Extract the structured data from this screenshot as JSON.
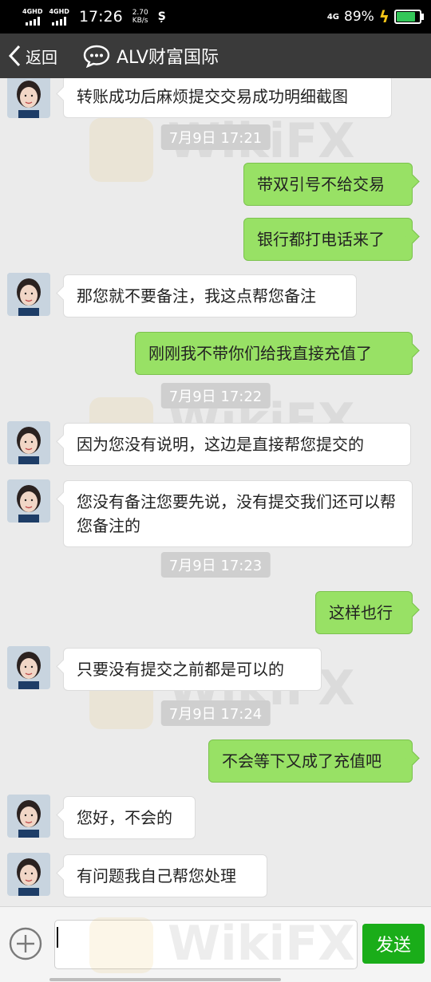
{
  "status": {
    "net1": "4GHD",
    "net2": "4GHD",
    "time": "17:26",
    "speed_value": "2.70",
    "speed_unit": "KB/s",
    "net_right": "4G",
    "battery_percent": "89%",
    "battery_level": 0.89
  },
  "header": {
    "back_label": "返回",
    "title": "ALV财富国际"
  },
  "messages": [
    {
      "type": "in",
      "text": "转账成功后麻烦提交交易成功明细截图"
    },
    {
      "type": "time",
      "text": "7月9日 17:21"
    },
    {
      "type": "out",
      "text": "带双引号不给交易"
    },
    {
      "type": "out",
      "text": "银行都打电话来了"
    },
    {
      "type": "in",
      "text": "那您就不要备注，我这点帮您备注"
    },
    {
      "type": "out",
      "text": "刚刚我不带你们给我直接充值了"
    },
    {
      "type": "time",
      "text": "7月9日 17:22"
    },
    {
      "type": "in",
      "text": "因为您没有说明，这边是直接帮您提交的"
    },
    {
      "type": "in",
      "text": "您没有备注您要先说，没有提交我们还可以帮您备注的"
    },
    {
      "type": "time",
      "text": "7月9日 17:23"
    },
    {
      "type": "out",
      "text": "这样也行"
    },
    {
      "type": "in",
      "text": "只要没有提交之前都是可以的"
    },
    {
      "type": "time",
      "text": "7月9日 17:24"
    },
    {
      "type": "out",
      "text": "不会等下又成了充值吧"
    },
    {
      "type": "in",
      "text": "您好，不会的"
    },
    {
      "type": "in",
      "text": "有问题我自己帮您处理"
    }
  ],
  "input": {
    "value": "",
    "send_label": "发送"
  },
  "watermark": "WikiFX",
  "colors": {
    "outgoing_bubble": "#98e165",
    "send_button": "#1aad19",
    "header_bg": "#3a3a3a"
  }
}
